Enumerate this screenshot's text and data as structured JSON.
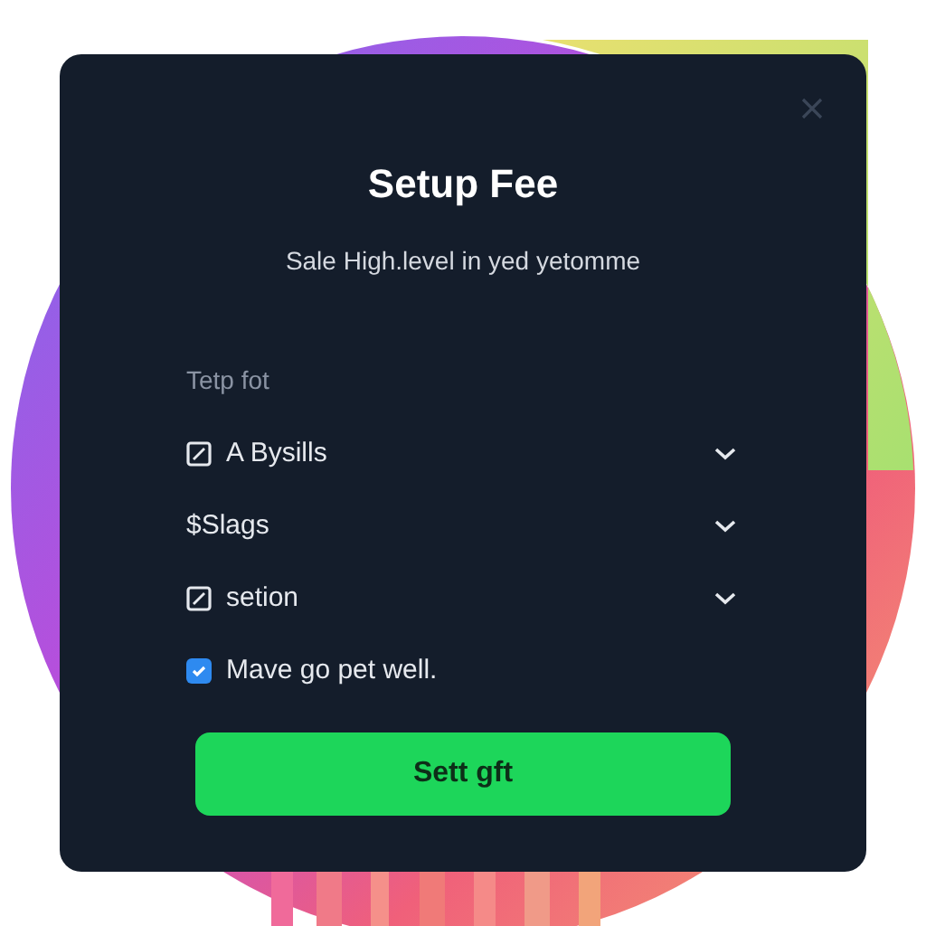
{
  "dialog": {
    "title": "Setup Fee",
    "subtitle": "Sale High.level in yed yetomme",
    "section_label": "Tetp fot",
    "rows": [
      {
        "kind": "icon-row",
        "label": "A Bysills"
      },
      {
        "kind": "text-row",
        "label": "$Slags"
      },
      {
        "kind": "icon-row",
        "label": "setion"
      }
    ],
    "checkbox": {
      "label": "Mave go pet well.",
      "checked": true
    },
    "button": "Sett gft"
  }
}
